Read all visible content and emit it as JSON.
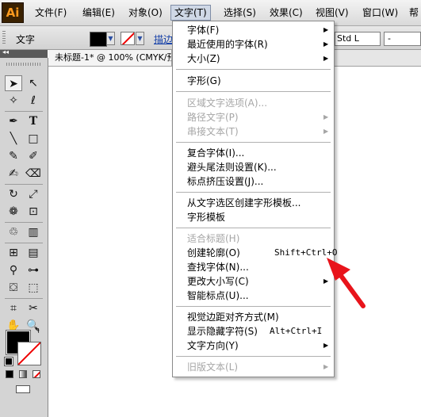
{
  "app": {
    "logo": "Ai"
  },
  "menubar": {
    "items": [
      {
        "label": "文件(F)"
      },
      {
        "label": "编辑(E)"
      },
      {
        "label": "对象(O)"
      },
      {
        "label": "文字(T)"
      },
      {
        "label": "选择(S)"
      },
      {
        "label": "效果(C)"
      },
      {
        "label": "视图(V)"
      },
      {
        "label": "窗口(W)"
      },
      {
        "label": "帮"
      }
    ]
  },
  "controlbar": {
    "label": "文字",
    "stroke_label": "描边",
    "font_style": "Std L",
    "font_size": "-"
  },
  "document": {
    "tab_title": "未标题-1* @ 100% (CMYK/预"
  },
  "menu": {
    "items": [
      {
        "label": "字体(F)"
      },
      {
        "label": "最近使用的字体(R)"
      },
      {
        "label": "大小(Z)"
      },
      {
        "label": "字形(G)"
      },
      {
        "label": "区域文字选项(A)..."
      },
      {
        "label": "路径文字(P)"
      },
      {
        "label": "串接文本(T)"
      },
      {
        "label": "复合字体(I)..."
      },
      {
        "label": "避头尾法则设置(K)..."
      },
      {
        "label": "标点挤压设置(J)..."
      },
      {
        "label": "从文字选区创建字形模板..."
      },
      {
        "label": "字形模板"
      },
      {
        "label": "适合标题(H)"
      },
      {
        "label": "创建轮廓(O)",
        "shortcut": "Shift+Ctrl+O"
      },
      {
        "label": "查找字体(N)..."
      },
      {
        "label": "更改大小写(C)"
      },
      {
        "label": "智能标点(U)..."
      },
      {
        "label": "视觉边距对齐方式(M)"
      },
      {
        "label": "显示隐藏字符(S)",
        "shortcut": "Alt+Ctrl+I"
      },
      {
        "label": "文字方向(Y)"
      },
      {
        "label": "旧版文本(L)"
      }
    ]
  },
  "colors": {
    "annotation_arrow": "#e8141b",
    "menu_highlight": "#cfd8e6"
  }
}
